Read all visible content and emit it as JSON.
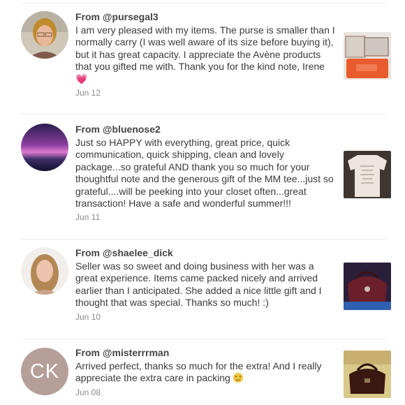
{
  "reviews": [
    {
      "from": "From @pursegal3",
      "text": "I am very pleased with my items. The purse is smaller than I normally carry (I was well aware of its size before buying it), but it has great capacity. I appreciate the Avène products that you gifted me with. Thank you for the kind note, Irene",
      "emoji": "💗",
      "date": "Jun 12"
    },
    {
      "from": "From @bluenose2",
      "text": "Just so HAPPY with everything, great price, quick communication, quick shipping, clean and lovely package...so grateful AND thank you so much for your thoughtful note and the generous gift of the MM tee...just so grateful....will be peeking into your closet often...great transaction! Have a safe and wonderful summer!!!",
      "date": "Jun 11"
    },
    {
      "from": "From @shaelee_dick",
      "text": "Seller was so sweet and doing business with her was a great experience. Items came packed nicely and arrived earlier than I anticipated. She added a nice little gift and I thought that was special. Thanks so much! :)",
      "date": "Jun 10"
    },
    {
      "from": "From @misterrrman",
      "text": "Arrived perfect, thanks so much for the extra! And I really appreciate the extra care in packing",
      "date": "Jun 08",
      "avatar_initials": "CK"
    }
  ],
  "colors": {
    "initials_avatar_bg": "#b79f99",
    "date_text": "#8a8a8a"
  }
}
